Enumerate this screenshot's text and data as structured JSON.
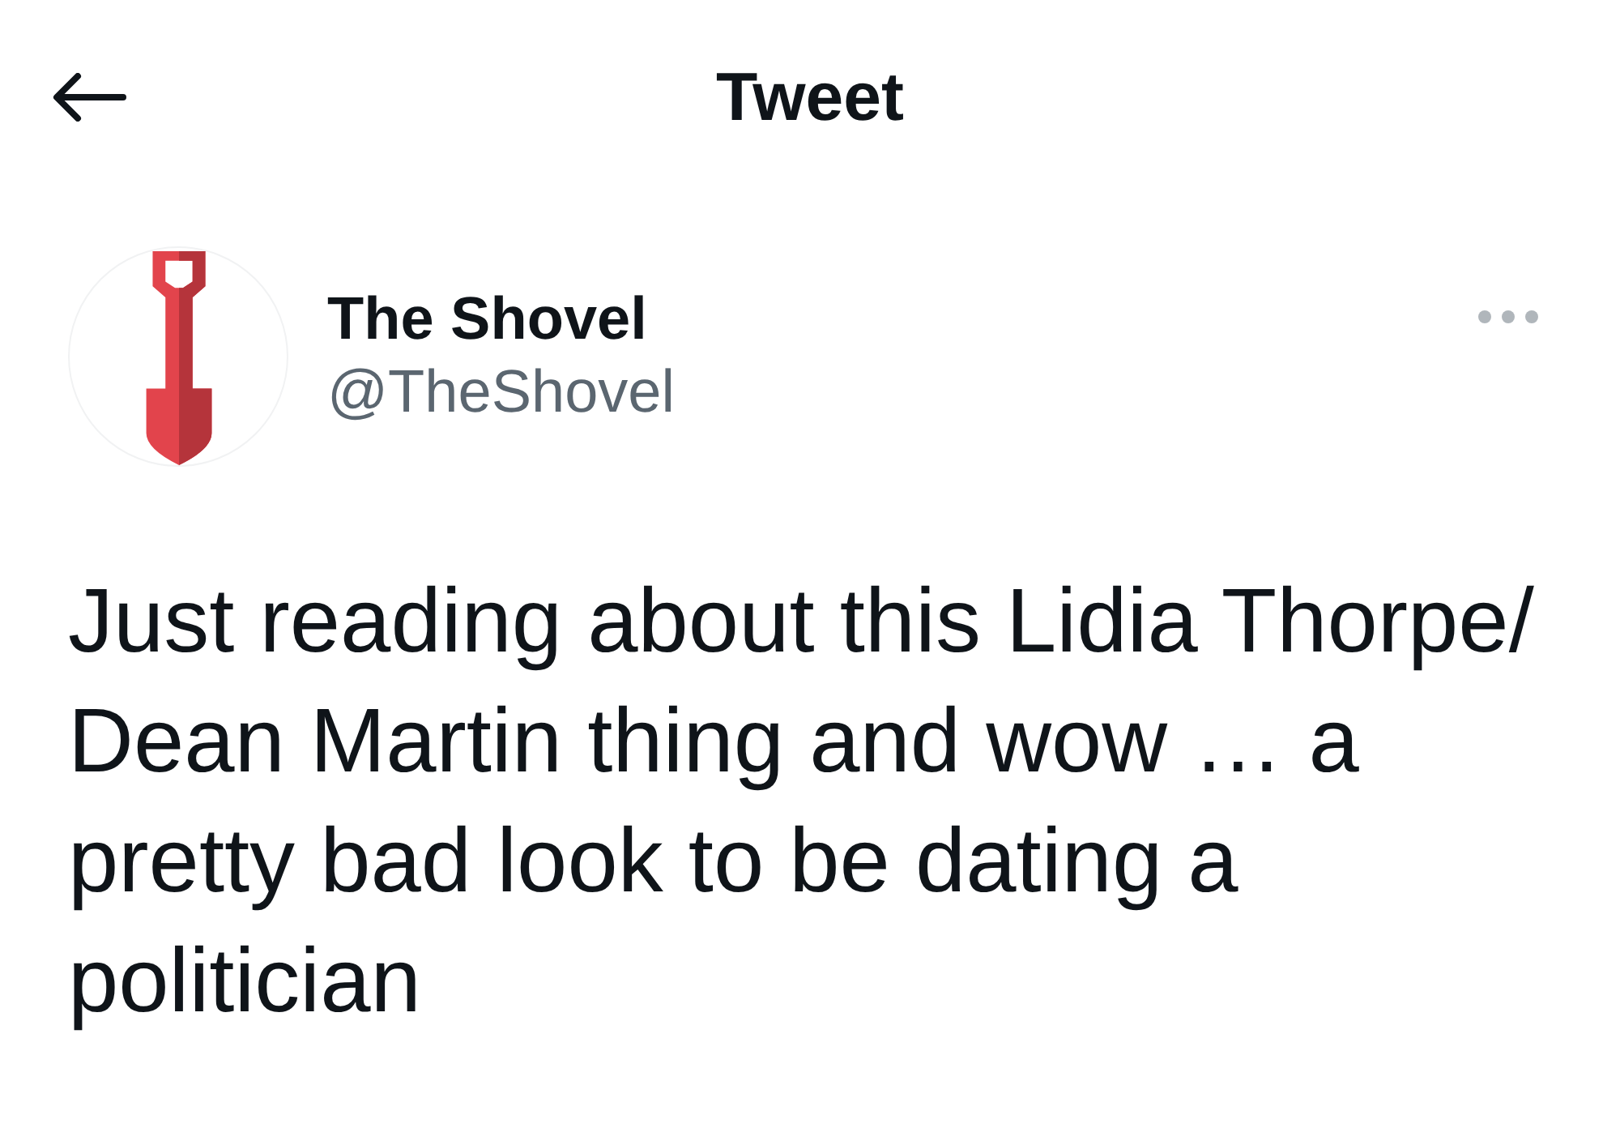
{
  "header": {
    "title": "Tweet"
  },
  "tweet": {
    "author": {
      "name": "The Shovel",
      "handle": "@TheShovel"
    },
    "text": "Just reading about this Lidia Thorpe/Dean Martin thing and wow … a pretty bad look to be dating a politician"
  }
}
